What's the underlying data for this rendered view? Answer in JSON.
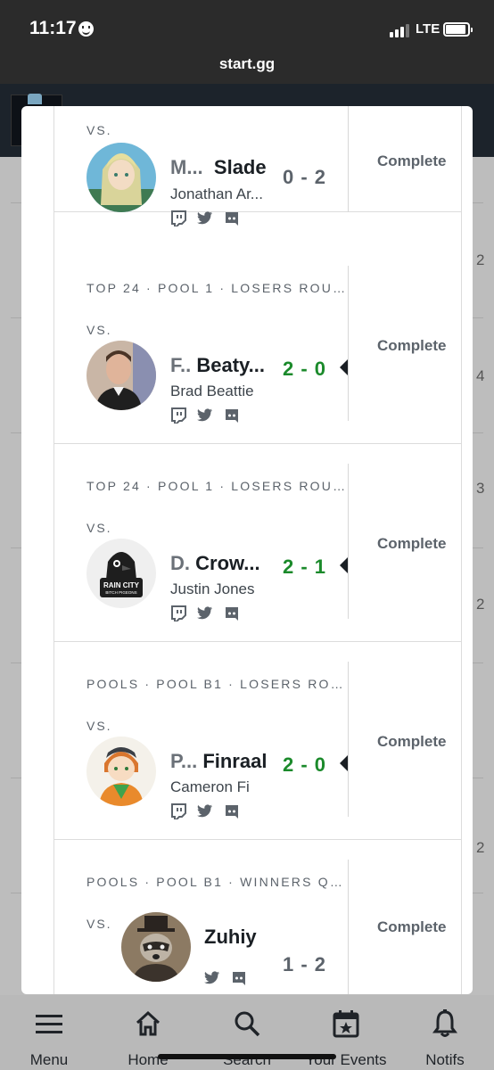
{
  "status_bar": {
    "time": "11:17",
    "network": "LTE"
  },
  "browser": {
    "url": "start.gg"
  },
  "background": {
    "digits": [
      "2",
      "4",
      "3",
      "2",
      "2"
    ]
  },
  "matches": [
    {
      "round": "",
      "vs": "VS.",
      "prefix": "M...",
      "gamertag": "Slade",
      "real_name": "Jonathan Ar...",
      "score": "0 - 2",
      "result": "loss",
      "status": "Complete",
      "socials": [
        "twitch-icon",
        "twitter-icon",
        "discord-icon"
      ],
      "avatar": "anime-blonde-avatar"
    },
    {
      "round": "TOP 24 · POOL 1 · LOSERS ROUN...",
      "vs": "VS.",
      "prefix": "F..",
      "gamertag": "Beaty...",
      "real_name": "Brad Beattie",
      "score": "2 - 0",
      "result": "win",
      "status": "Complete",
      "socials": [
        "twitch-icon",
        "twitter-icon",
        "discord-icon"
      ],
      "avatar": "photo-man-avatar"
    },
    {
      "round": "TOP 24 · POOL 1 · LOSERS ROUN...",
      "vs": "VS.",
      "prefix": "D.",
      "gamertag": "Crow...",
      "real_name": "Justin Jones",
      "score": "2 - 1",
      "result": "win",
      "status": "Complete",
      "socials": [
        "twitch-icon",
        "twitter-icon",
        "discord-icon"
      ],
      "avatar": "rain-city-logo-avatar"
    },
    {
      "round": "POOLS · POOL B1 · LOSERS ROU...",
      "vs": "VS.",
      "prefix": "P...",
      "gamertag": "Finraal",
      "real_name": "Cameron Fi",
      "score": "2 - 0",
      "result": "win",
      "status": "Complete",
      "socials": [
        "twitch-icon",
        "twitter-icon",
        "discord-icon"
      ],
      "avatar": "anime-ginger-avatar"
    },
    {
      "round": "POOLS · POOL B1 · WINNERS QU...",
      "vs": "VS.",
      "prefix": "",
      "gamertag": "Zuhiy",
      "real_name": "",
      "score": "1 - 2",
      "result": "loss",
      "status": "Complete",
      "socials": [
        "twitter-icon",
        "discord-icon"
      ],
      "avatar": "raccoon-avatar"
    }
  ],
  "bottom_nav": [
    {
      "label": "Menu",
      "icon": "menu-icon"
    },
    {
      "label": "Home",
      "icon": "home-icon"
    },
    {
      "label": "Search",
      "icon": "search-icon"
    },
    {
      "label": "Your Events",
      "icon": "calendar-star-icon"
    },
    {
      "label": "Notifs",
      "icon": "bell-icon"
    }
  ],
  "colors": {
    "win": "#1b8a2b",
    "loss": "#5c636b",
    "header": "#1c232b"
  }
}
